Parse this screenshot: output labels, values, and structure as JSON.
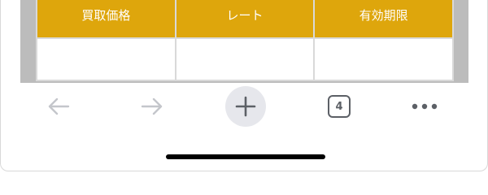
{
  "table": {
    "headers": [
      "買取価格",
      "レート",
      "有効期限"
    ],
    "rows": [
      [
        "",
        "",
        ""
      ]
    ]
  },
  "toolbar": {
    "back_icon": "arrow-left-icon",
    "forward_icon": "arrow-right-icon",
    "new_tab_icon": "plus-icon",
    "tab_count": "4",
    "menu_icon": "more-dots-icon"
  },
  "colors": {
    "table_header_bg": "#dea60c",
    "table_header_text": "#ffffff",
    "table_border": "#d9d9d9",
    "page_side_bg": "#bcbcbc",
    "toolbar_icon_disabled": "#c4c6cb",
    "toolbar_icon": "#5c6066",
    "new_tab_bg": "#e6e7ec"
  }
}
